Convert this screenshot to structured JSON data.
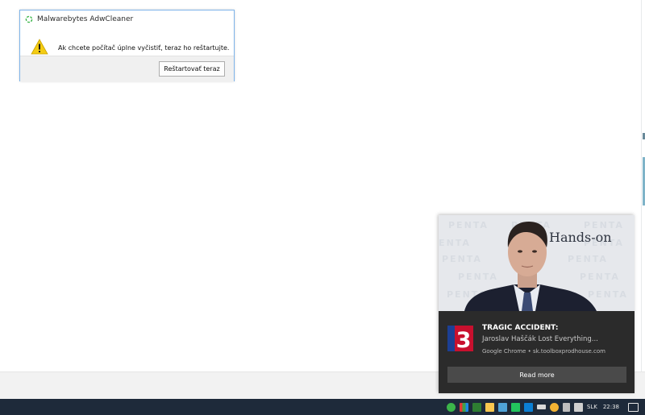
{
  "dialog": {
    "title": "Malwarebytes AdwCleaner",
    "message": "Ak chcete počítač úplne vyčistiť, teraz ho reštartujte.",
    "button_label": "Reštartovať teraz",
    "icon": "warning-icon",
    "logo": "adwcleaner-logo-icon"
  },
  "toast": {
    "hero_text": "Hands-on",
    "watermark_text": "PENTA",
    "title": "TRAGIC ACCIDENT:",
    "body": "Jaroslav Haščák Lost Everything...",
    "attribution": "Google Chrome • sk.toolboxprodhouse.com",
    "action_label": "Read more",
    "app_logo": "tv-channel-3-logo-icon"
  },
  "taskbar": {
    "language": "SLK",
    "time": "22:38",
    "tray_icons": [
      "malwarebytes-icon",
      "colored-grid-icon",
      "network-share-icon",
      "folder-icon",
      "monitor-icon",
      "green-app-icon",
      "dropbox-icon",
      "battery-icon",
      "chrome-icon",
      "volume-icon",
      "network-icon",
      "notification-icon"
    ]
  },
  "colors": {
    "dialog_border": "#7eb4ea",
    "toast_background": "#2b2b2b",
    "toast_button": "#4a4a4a",
    "taskbar": "#1e2a3a",
    "logo_red": "#c8102e",
    "logo_blue": "#1c3f94"
  }
}
